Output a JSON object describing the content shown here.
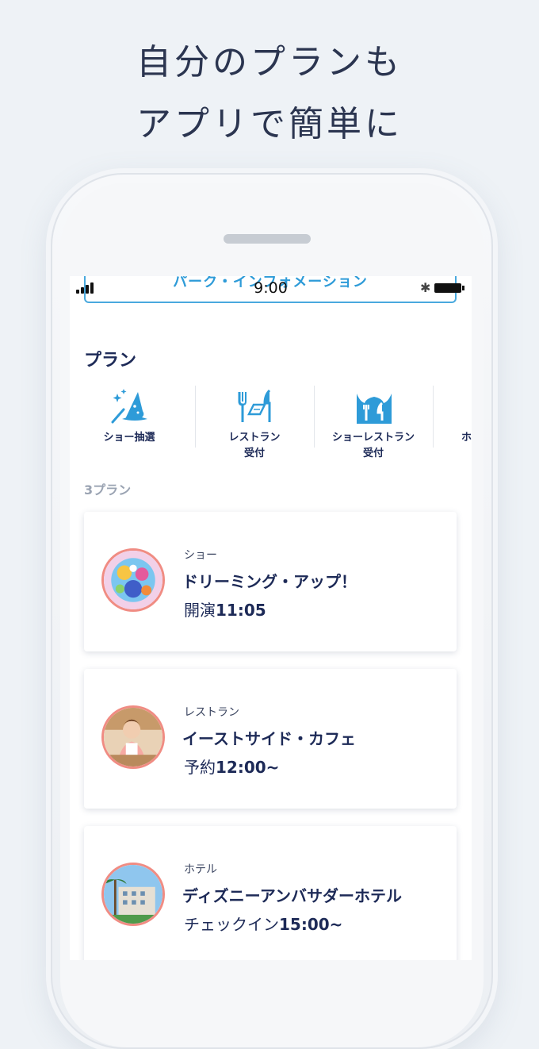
{
  "headline": {
    "line1": "自分のプランも",
    "line2": "アプリで簡単に"
  },
  "status_bar": {
    "time": "9:00"
  },
  "info_button_label": "パーク・インフォメーション",
  "section_title": "プラン",
  "categories": [
    {
      "label_line1": "ショー抽選",
      "label_line2": "",
      "icon": "magic-hat-icon"
    },
    {
      "label_line1": "レストラン",
      "label_line2": "受付",
      "icon": "restaurant-icon"
    },
    {
      "label_line1": "ショーレストラン",
      "label_line2": "受付",
      "icon": "show-restaurant-icon"
    },
    {
      "label_line1": "ホ",
      "label_line2": "",
      "icon": "hotel-icon"
    }
  ],
  "plan_count": "3プラン",
  "plans": [
    {
      "category": "ショー",
      "name": "ドリーミング・アップ！",
      "prefix": "開演",
      "value": "11:05"
    },
    {
      "category": "レストラン",
      "name": "イーストサイド・カフェ",
      "prefix": "予約",
      "value": "12:00~"
    },
    {
      "category": "ホテル",
      "name": "ディズニーアンバサダーホテル",
      "prefix": "チェックイン",
      "value": "15:00~"
    }
  ],
  "colors": {
    "accent": "#2e9bd8",
    "navy": "#1d2a57",
    "thumb_border": "#f08c83"
  }
}
